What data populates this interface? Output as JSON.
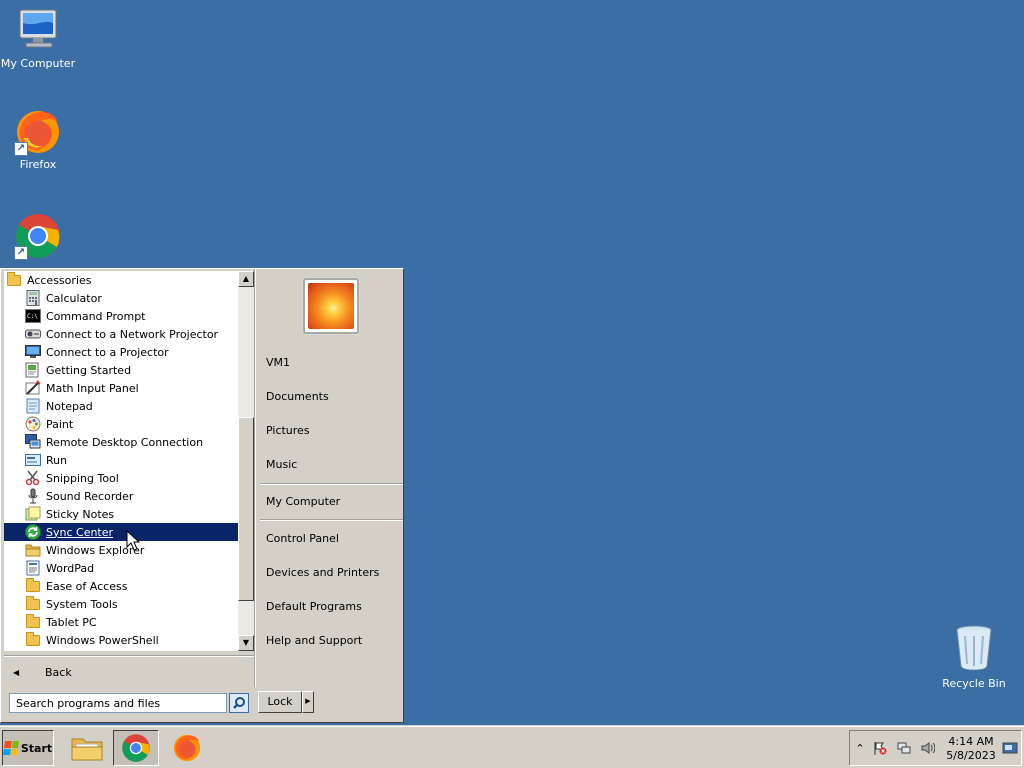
{
  "desktop": {
    "icons": [
      {
        "label": "My Computer"
      },
      {
        "label": "Firefox"
      },
      {
        "label": "Google Chrome"
      },
      {
        "label": "Recycle Bin"
      }
    ]
  },
  "start_menu": {
    "programs": [
      {
        "label": "Accessories",
        "icon": "folder-icon",
        "level": 0
      },
      {
        "label": "Calculator",
        "icon": "calculator-icon",
        "level": 1
      },
      {
        "label": "Command Prompt",
        "icon": "command-prompt-icon",
        "level": 1
      },
      {
        "label": "Connect to a Network Projector",
        "icon": "network-projector-icon",
        "level": 1
      },
      {
        "label": "Connect to a Projector",
        "icon": "projector-icon",
        "level": 1
      },
      {
        "label": "Getting Started",
        "icon": "getting-started-icon",
        "level": 1
      },
      {
        "label": "Math Input Panel",
        "icon": "math-input-icon",
        "level": 1
      },
      {
        "label": "Notepad",
        "icon": "notepad-icon",
        "level": 1
      },
      {
        "label": "Paint",
        "icon": "paint-icon",
        "level": 1
      },
      {
        "label": "Remote Desktop Connection",
        "icon": "remote-desktop-icon",
        "level": 1
      },
      {
        "label": "Run",
        "icon": "run-icon",
        "level": 1
      },
      {
        "label": "Snipping Tool",
        "icon": "snipping-tool-icon",
        "level": 1
      },
      {
        "label": "Sound Recorder",
        "icon": "microphone-icon",
        "level": 1
      },
      {
        "label": "Sticky Notes",
        "icon": "sticky-notes-icon",
        "level": 1
      },
      {
        "label": "Sync Center",
        "icon": "sync-center-icon",
        "level": 1,
        "selected": true
      },
      {
        "label": "Windows Explorer",
        "icon": "windows-explorer-icon",
        "level": 1
      },
      {
        "label": "WordPad",
        "icon": "wordpad-icon",
        "level": 1
      },
      {
        "label": "Ease of Access",
        "icon": "folder-icon",
        "level": 1
      },
      {
        "label": "System Tools",
        "icon": "folder-icon",
        "level": 1
      },
      {
        "label": "Tablet PC",
        "icon": "folder-icon",
        "level": 1
      },
      {
        "label": "Windows PowerShell",
        "icon": "folder-icon",
        "level": 1
      }
    ],
    "back_label": "Back",
    "search_placeholder": "Search programs and files",
    "right_items": {
      "user": "VM1",
      "documents": "Documents",
      "pictures": "Pictures",
      "music": "Music",
      "computer": "My Computer",
      "control_panel": "Control Panel",
      "devices": "Devices and Printers",
      "default_programs": "Default Programs",
      "help": "Help and Support"
    },
    "lock_label": "Lock"
  },
  "taskbar": {
    "start_label": "Start",
    "apps": [
      {
        "name": "Windows Explorer",
        "icon": "folder-icon"
      },
      {
        "name": "Google Chrome",
        "icon": "chrome-icon",
        "active": true
      },
      {
        "name": "Firefox",
        "icon": "firefox-icon"
      }
    ],
    "clock": {
      "time": "4:14 AM",
      "date": "5/8/2023"
    }
  },
  "colors": {
    "desktop": "#3a6ea5",
    "selection": "#0a246a",
    "face": "#d4d0c8"
  }
}
